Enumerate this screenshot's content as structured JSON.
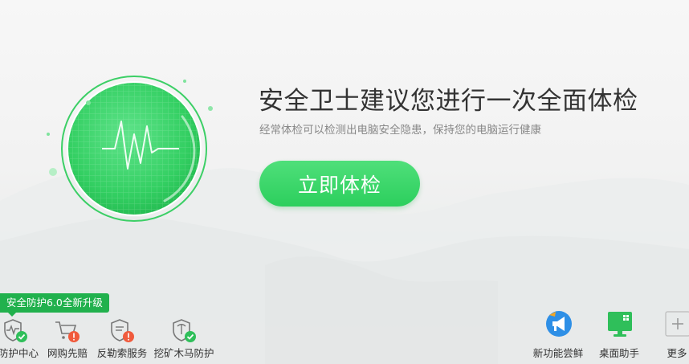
{
  "headline": "安全卫士建议您进行一次全面体检",
  "subline": "经常体检可以检测出电脑安全隐患，保持您的电脑运行健康",
  "check_button": "立即体检",
  "upgrade_badge": "安全防护6.0全新升级",
  "features": [
    {
      "label": "防护中心",
      "icon": "shield-heartbeat-icon",
      "status": "ok"
    },
    {
      "label": "网购先赔",
      "icon": "shopping-cart-icon",
      "status": "warning"
    },
    {
      "label": "反勒索服务",
      "icon": "shield-document-icon",
      "status": "warning"
    },
    {
      "label": "挖矿木马防护",
      "icon": "shield-pickaxe-icon",
      "status": "ok"
    }
  ],
  "right_tools": [
    {
      "label": "新功能尝鲜",
      "icon": "megaphone-icon"
    },
    {
      "label": "桌面助手",
      "icon": "desktop-monitor-icon"
    },
    {
      "label": "更多",
      "icon": "plus-icon"
    }
  ],
  "colors": {
    "accent_green": "#2ccf5d",
    "badge_green": "#21b14d",
    "ok_green": "#2fbf5a",
    "warning_red": "#f05a3c",
    "blue": "#2e8fe6"
  }
}
